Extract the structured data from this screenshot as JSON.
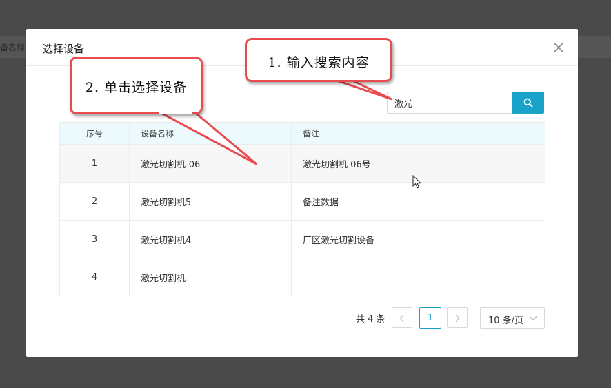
{
  "background": {
    "strip_text": "备名称"
  },
  "modal": {
    "title": "选择设备",
    "close_icon": "close-icon"
  },
  "search": {
    "value": "激光",
    "placeholder": "",
    "button_icon": "search-icon"
  },
  "table": {
    "headers": {
      "index": "序号",
      "name": "设备名称",
      "remark": "备注"
    },
    "rows": [
      {
        "index": "1",
        "name": "激光切割机-06",
        "remark": "激光切割机 06号"
      },
      {
        "index": "2",
        "name": "激光切割机5",
        "remark": "备注数据"
      },
      {
        "index": "3",
        "name": "激光切割机4",
        "remark": "厂区激光切割设备"
      },
      {
        "index": "4",
        "name": "激光切割机",
        "remark": ""
      }
    ]
  },
  "pagination": {
    "total_text": "共 4 条",
    "current_page": "1",
    "page_size": "10 条/页",
    "prev_icon": "chevron-left-icon",
    "next_icon": "chevron-right-icon",
    "dropdown_icon": "chevron-down-icon"
  },
  "callouts": {
    "step1": "1. 输入搜索内容",
    "step2": "2. 单击选择设备"
  },
  "colors": {
    "accent": "#1aa3c9",
    "callout_border": "#e84c4f",
    "header_bg": "#edfafd",
    "overlay": "#4a4a4a"
  }
}
